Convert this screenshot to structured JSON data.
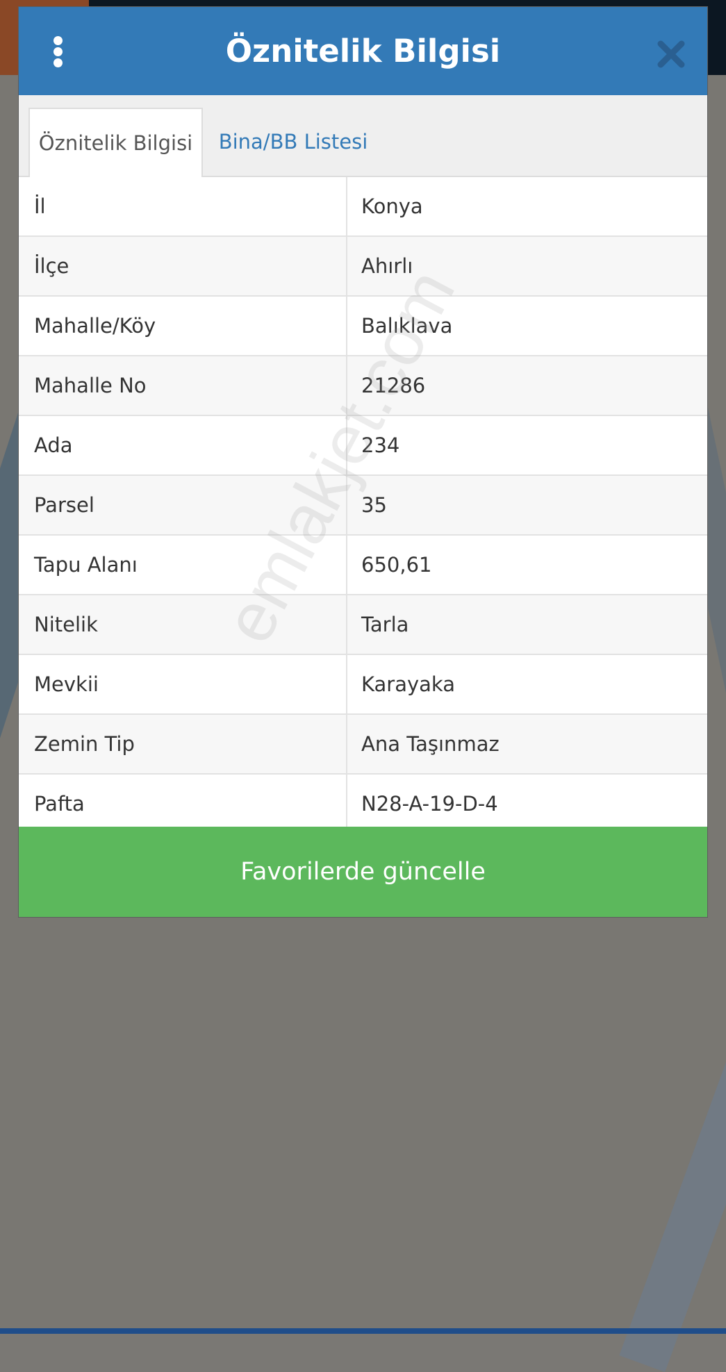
{
  "header": {
    "title": "Öznitelik Bilgisi",
    "menu_icon": "kebab-menu-icon",
    "close_icon": "close-icon"
  },
  "tabs": [
    {
      "label": "Öznitelik Bilgisi",
      "active": true
    },
    {
      "label": "Bina/BB Listesi",
      "active": false
    }
  ],
  "attributes": [
    {
      "label": "İl",
      "value": "Konya"
    },
    {
      "label": "İlçe",
      "value": "Ahırlı"
    },
    {
      "label": "Mahalle/Köy",
      "value": "Balıklava"
    },
    {
      "label": "Mahalle No",
      "value": "21286"
    },
    {
      "label": "Ada",
      "value": "234"
    },
    {
      "label": "Parsel",
      "value": "35"
    },
    {
      "label": "Tapu Alanı",
      "value": "650,61"
    },
    {
      "label": "Nitelik",
      "value": "Tarla"
    },
    {
      "label": "Mevkii",
      "value": "Karayaka"
    },
    {
      "label": "Zemin Tip",
      "value": "Ana Taşınmaz"
    },
    {
      "label": "Pafta",
      "value": "N28-A-19-D-4"
    }
  ],
  "footer": {
    "button_label": "Favorilerde güncelle"
  },
  "watermark": "emlakjet.com",
  "colors": {
    "header_bg": "#337ab7",
    "tab_link": "#337ab7",
    "button_bg": "#5cb85c"
  }
}
